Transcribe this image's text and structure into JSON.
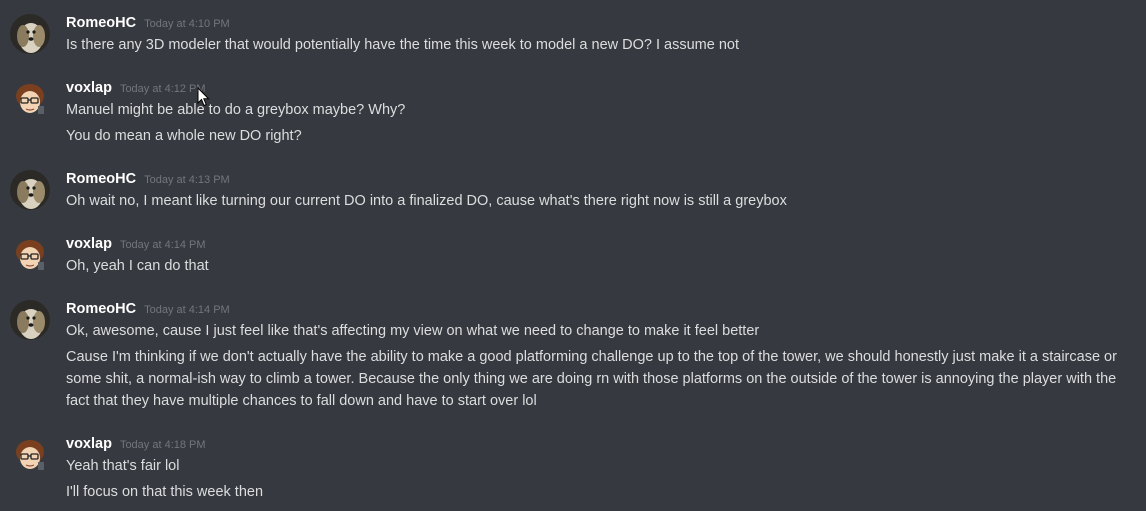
{
  "colors": {
    "background": "#36393f",
    "username": "#ffffff",
    "timestamp": "#72767d",
    "message_text": "#dcddde"
  },
  "messages": [
    {
      "author": "RomeoHC",
      "avatar_icon": "dog-avatar-icon",
      "timestamp": "Today at 4:10 PM",
      "lines": [
        "Is there any 3D modeler that would potentially have the time this week to model a new DO? I assume not"
      ]
    },
    {
      "author": "voxlap",
      "avatar_icon": "cartoon-glasses-avatar-icon",
      "timestamp": "Today at 4:12 PM",
      "lines": [
        "Manuel might be able to do a greybox maybe? Why?",
        "You do mean a whole new DO right?"
      ]
    },
    {
      "author": "RomeoHC",
      "avatar_icon": "dog-avatar-icon",
      "timestamp": "Today at 4:13 PM",
      "lines": [
        "Oh wait no, I meant like turning our current DO into a finalized DO, cause what's there right now is still a greybox"
      ]
    },
    {
      "author": "voxlap",
      "avatar_icon": "cartoon-glasses-avatar-icon",
      "timestamp": "Today at 4:14 PM",
      "lines": [
        "Oh, yeah I can do that"
      ]
    },
    {
      "author": "RomeoHC",
      "avatar_icon": "dog-avatar-icon",
      "timestamp": "Today at 4:14 PM",
      "lines": [
        "Ok, awesome, cause I just feel like that's affecting my view on what we need to change to make it feel better",
        "Cause I'm thinking if we don't actually have the ability to make a good platforming challenge up to the top of the tower, we should honestly just make it a staircase or some shit, a normal-ish way to climb a tower. Because the only thing we are doing rn with those platforms on the outside of the tower is annoying the player with the fact that they have multiple chances to fall down and have to start over lol"
      ]
    },
    {
      "author": "voxlap",
      "avatar_icon": "cartoon-glasses-avatar-icon",
      "timestamp": "Today at 4:18 PM",
      "lines": [
        "Yeah that's fair lol",
        "I'll focus on that this week then"
      ]
    }
  ]
}
